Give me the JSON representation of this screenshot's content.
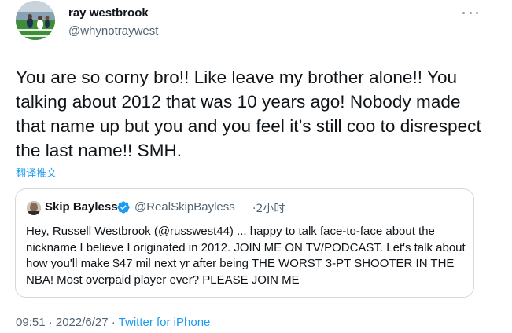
{
  "author": {
    "name": "ray westbrook",
    "handle": "@whynotraywest"
  },
  "tweet": {
    "text": "You are so corny bro!! Like leave my brother alone!! You talking about 2012 that was 10 years ago! Nobody made that name up but you and you feel it’s still coo to disrespect the last name!! SMH.",
    "translate_label": "翻译推文"
  },
  "quote": {
    "name": "Skip Bayless",
    "handle": "@RealSkipBayless",
    "time": "·2小时",
    "text": "Hey, Russell Westbrook (@russwest44) ... happy to talk face-to-face about the nickname I believe I originated in 2012. JOIN ME ON TV/PODCAST. Let's talk about how you'll make $47 mil next yr after being THE WORST 3-PT SHOOTER IN THE NBA! Most overpaid player ever? PLEASE JOIN ME"
  },
  "meta": {
    "timestamp": "09:51 · 2022/6/27 · ",
    "source": "Twitter for iPhone"
  },
  "icons": {
    "more": "more-icon",
    "verified": "verified-icon"
  },
  "colors": {
    "link": "#1d9bf0",
    "secondary_text": "#536471",
    "border": "#cfd9de"
  }
}
